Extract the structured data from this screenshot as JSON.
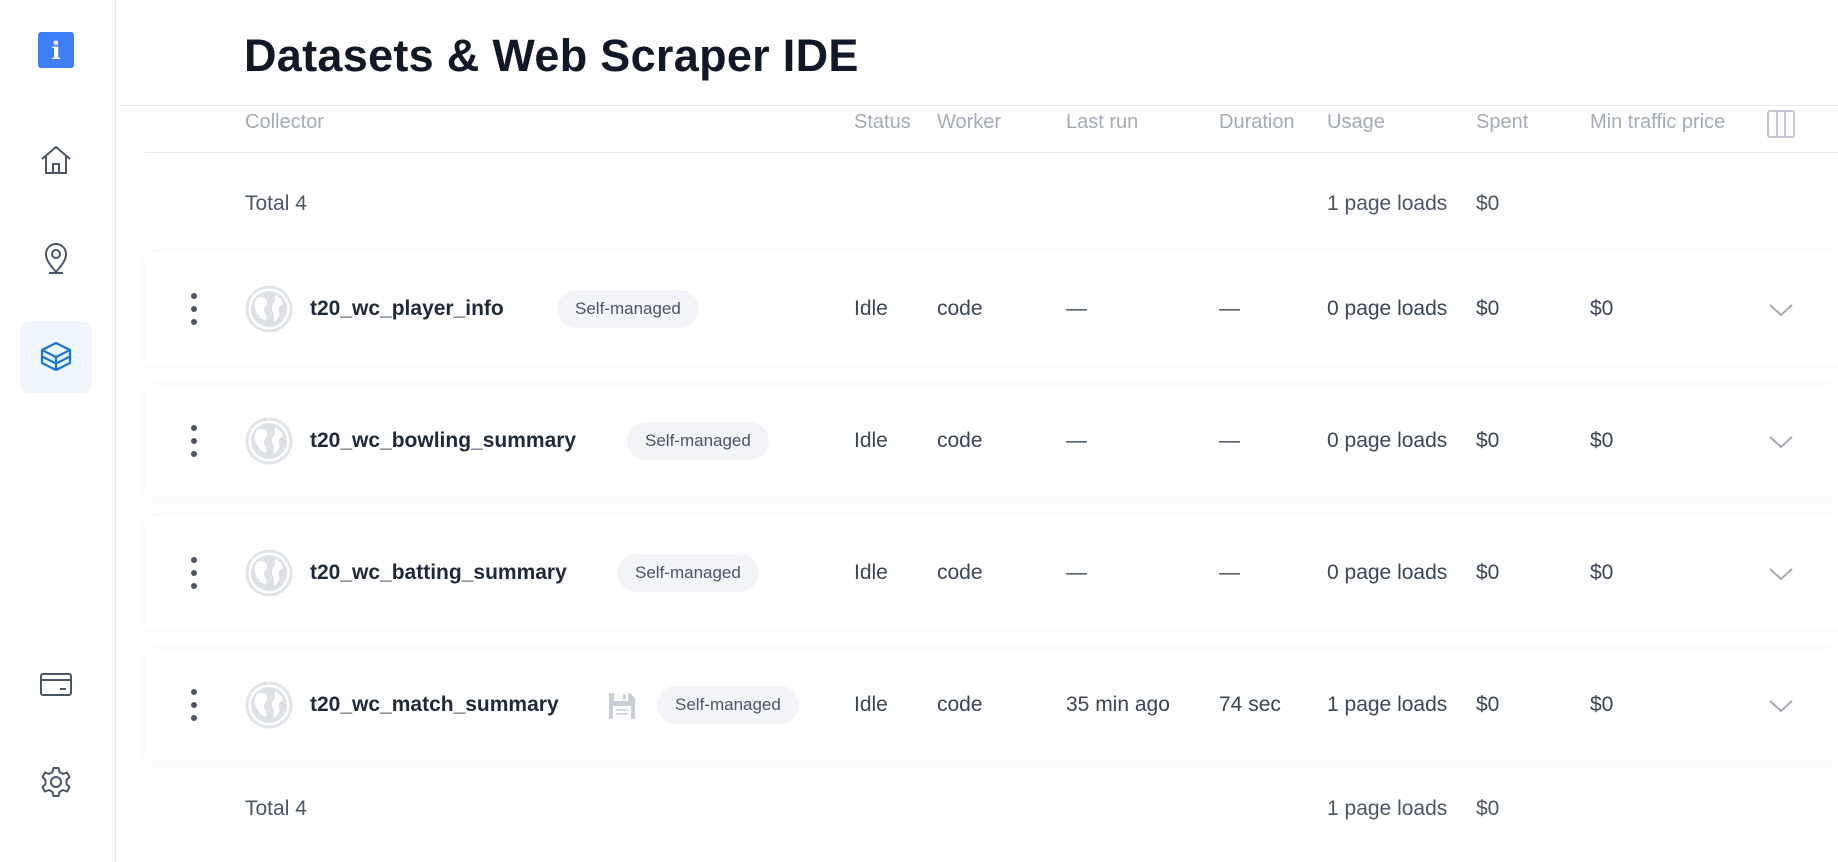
{
  "page": {
    "title": "Datasets & Web Scraper IDE"
  },
  "sidebar": {
    "logo_glyph": "i",
    "icons": [
      "home-icon",
      "location-pin-icon",
      "datasets-layers-icon",
      "billing-card-icon",
      "settings-gear-icon"
    ],
    "active": "datasets-layers-icon"
  },
  "colors": {
    "accent": "#3f7ff6",
    "active_bg": "#eef5fc"
  },
  "table": {
    "columns": {
      "collector": "Collector",
      "status": "Status",
      "worker": "Worker",
      "last_run": "Last run",
      "duration": "Duration",
      "usage": "Usage",
      "spent": "Spent",
      "min_traffic_price": "Min traffic price"
    },
    "total_top": {
      "label": "Total 4",
      "usage": "1 page loads",
      "spent": "$0"
    },
    "rows": [
      {
        "name": "t20_wc_player_info",
        "badge": "Self-managed",
        "status": "Idle",
        "worker": "code",
        "last_run": "—",
        "duration": "—",
        "usage": "0 page loads",
        "spent": "$0",
        "min_price": "$0"
      },
      {
        "name": "t20_wc_bowling_summary",
        "badge": "Self-managed",
        "status": "Idle",
        "worker": "code",
        "last_run": "—",
        "duration": "—",
        "usage": "0 page loads",
        "spent": "$0",
        "min_price": "$0"
      },
      {
        "name": "t20_wc_batting_summary",
        "badge": "Self-managed",
        "status": "Idle",
        "worker": "code",
        "last_run": "—",
        "duration": "—",
        "usage": "0 page loads",
        "spent": "$0",
        "min_price": "$0"
      },
      {
        "name": "t20_wc_match_summary",
        "badge": "Self-managed",
        "status": "Idle",
        "worker": "code",
        "last_run": "35 min ago",
        "duration": "74 sec",
        "usage": "1 page loads",
        "spent": "$0",
        "min_price": "$0"
      }
    ],
    "total_bottom": {
      "label": "Total 4",
      "usage": "1 page loads",
      "spent": "$0"
    }
  }
}
